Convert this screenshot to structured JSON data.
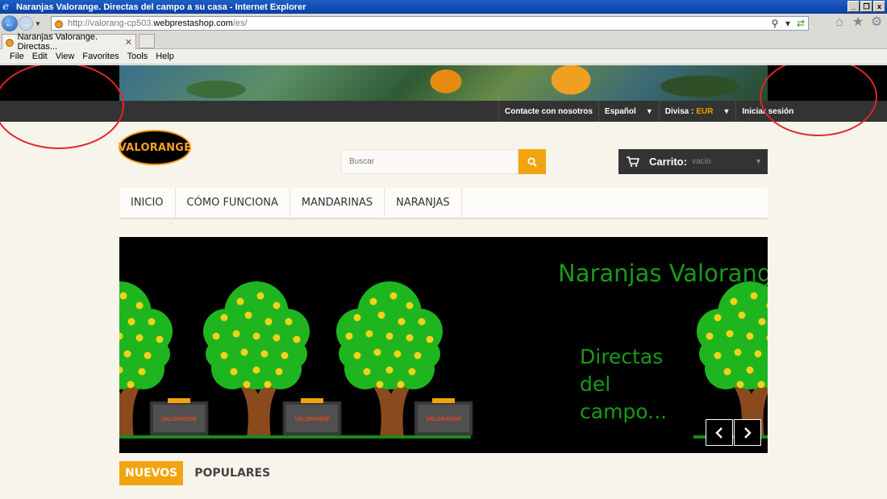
{
  "window": {
    "title": "Naranjas Valorange. Directas del campo a su casa - Internet Explorer"
  },
  "address": {
    "url_prefix": "http://valorang-cp503.",
    "url_host": "webprestashop.com",
    "url_suffix": "/es/"
  },
  "tab": {
    "label": "Naranjas Valorange. Directas..."
  },
  "menu": [
    "File",
    "Edit",
    "View",
    "Favorites",
    "Tools",
    "Help"
  ],
  "site": {
    "topnav": {
      "contact": "Contacte con nosotros",
      "language": "Español",
      "currency_label": "Divisa :",
      "currency_value": "EUR",
      "login": "Iniciar sesión"
    },
    "logo_text": "VALORANGE",
    "search": {
      "placeholder": "Buscar"
    },
    "cart": {
      "label": "Carrito:",
      "status": "vacío"
    },
    "main_menu": [
      "INICIO",
      "CÓMO FUNCIONA",
      "MANDARINAS",
      "NARANJAS"
    ],
    "slide": {
      "title": "Naranjas Valorange",
      "subtitle_lines": [
        "Directas",
        "del",
        "campo..."
      ],
      "crate_label": "VALORANGE"
    },
    "product_tabs": {
      "new": "NUEVOS",
      "popular": "POPULARES"
    }
  },
  "colors": {
    "accent": "#f1a40e",
    "topbar": "#333333",
    "annotation": "#e0262a",
    "tree_green": "#1fb51f",
    "fruit_yellow": "#f2d21a",
    "trunk_brown": "#8a4a1e"
  }
}
